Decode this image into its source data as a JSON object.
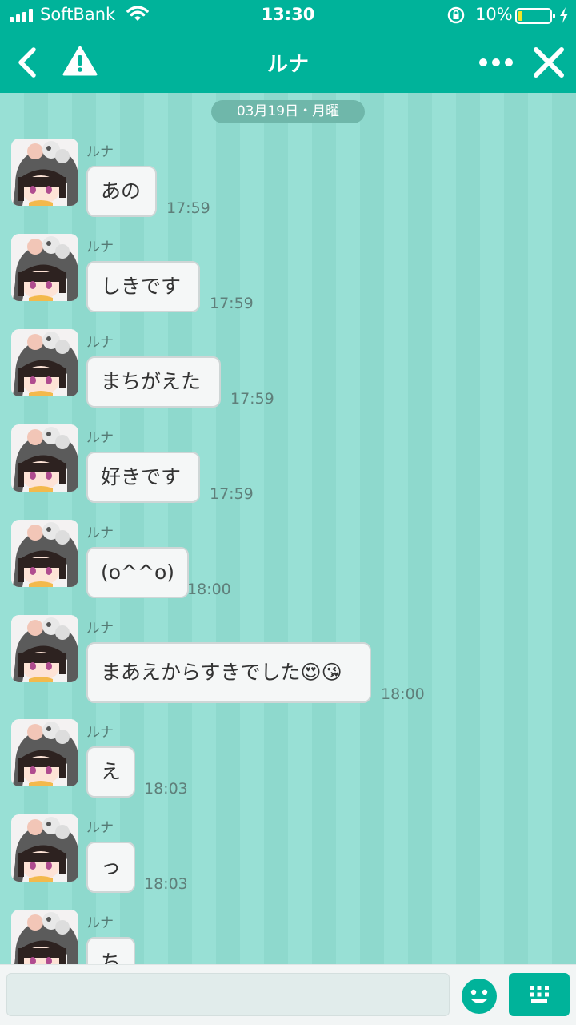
{
  "status": {
    "carrier": "SoftBank",
    "time": "13:30",
    "battery_percent": "10%",
    "battery_level": 0.1
  },
  "header": {
    "title": "ルナ"
  },
  "date_label": "03月19日・月曜",
  "messages": [
    {
      "sender": "ルナ",
      "text": "あの",
      "time": "17:59"
    },
    {
      "sender": "ルナ",
      "text": "しきです",
      "time": "17:59"
    },
    {
      "sender": "ルナ",
      "text": "まちがえた",
      "time": "17:59"
    },
    {
      "sender": "ルナ",
      "text": "好きです",
      "time": "17:59"
    },
    {
      "sender": "ルナ",
      "text": "(o^^o)",
      "time": "18:00"
    },
    {
      "sender": "ルナ",
      "text": "まあえからすきでした😍😘",
      "time": "18:00"
    },
    {
      "sender": "ルナ",
      "text": "え",
      "time": "18:03"
    },
    {
      "sender": "ルナ",
      "text": "っ",
      "time": "18:03"
    },
    {
      "sender": "ルナ",
      "text": "ち",
      "time": ""
    }
  ],
  "colors": {
    "accent": "#00b39a",
    "chat_background": "#98e0d4",
    "bubble": "#f5f7f7"
  },
  "icons": {
    "back": "chevron-left-icon",
    "report": "warning-icon",
    "more": "more-dots-icon",
    "close": "close-icon",
    "emoji": "smiley-icon",
    "keyboard": "keyboard-icon"
  }
}
